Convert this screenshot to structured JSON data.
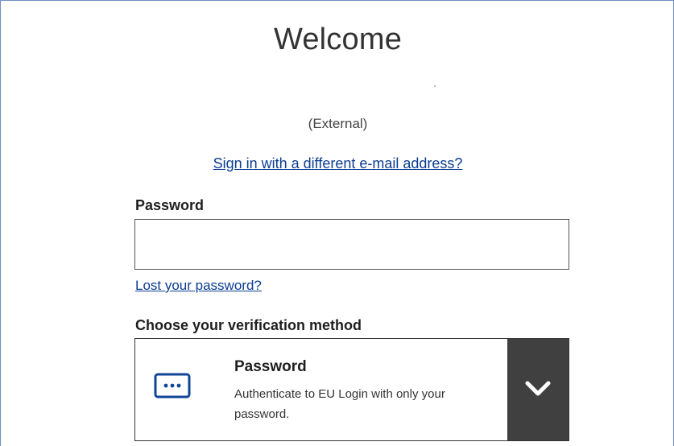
{
  "page": {
    "title": "Welcome",
    "user_type": "(External)",
    "switch_account_link": "Sign in with a different e-mail address?"
  },
  "password": {
    "label": "Password",
    "value": "",
    "placeholder": "",
    "lost_link": "Lost your password?"
  },
  "verification": {
    "label": "Choose your verification method",
    "selected": {
      "icon": "password-dots-icon",
      "name": "Password",
      "description": "Authenticate to EU Login with only your password."
    },
    "toggle_icon": "chevron-down-icon"
  },
  "colors": {
    "link": "#0b3d91",
    "icon_blue": "#0e4596",
    "toggle_bg": "#404040"
  }
}
